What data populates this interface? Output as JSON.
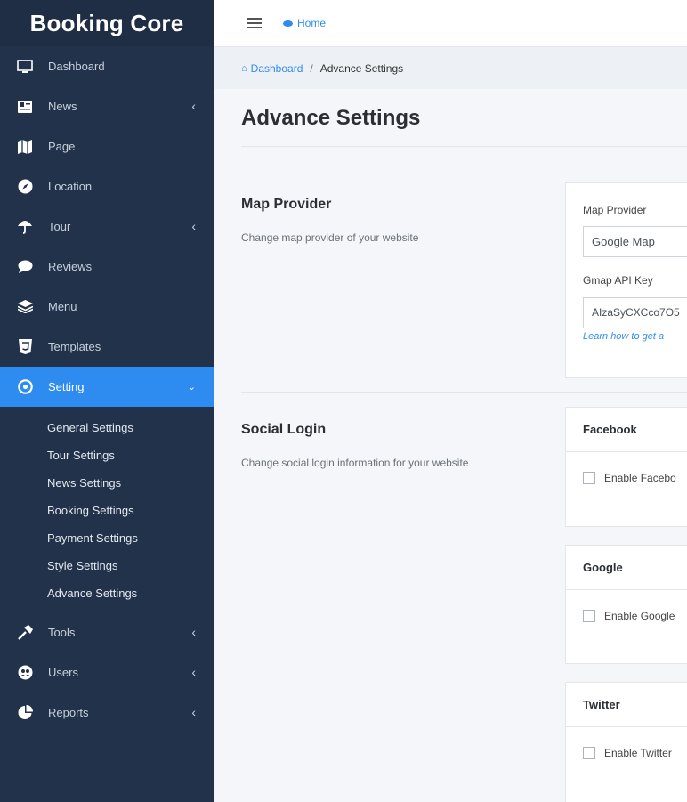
{
  "sidebar": {
    "brand": "Booking Core",
    "items": [
      {
        "label": "Dashboard",
        "icon": "monitor-icon",
        "has_chevron": false
      },
      {
        "label": "News",
        "icon": "newspaper-icon",
        "has_chevron": true
      },
      {
        "label": "Page",
        "icon": "map-icon",
        "has_chevron": false
      },
      {
        "label": "Location",
        "icon": "compass-icon",
        "has_chevron": false
      },
      {
        "label": "Tour",
        "icon": "umbrella-icon",
        "has_chevron": true
      },
      {
        "label": "Reviews",
        "icon": "comment-icon",
        "has_chevron": false
      },
      {
        "label": "Menu",
        "icon": "layers-icon",
        "has_chevron": false
      },
      {
        "label": "Templates",
        "icon": "html5-icon",
        "has_chevron": false
      },
      {
        "label": "Setting",
        "icon": "cog-icon",
        "has_chevron": true,
        "active": true
      }
    ],
    "submenu": [
      "General Settings",
      "Tour Settings",
      "News Settings",
      "Booking Settings",
      "Payment Settings",
      "Style Settings",
      "Advance Settings"
    ],
    "items_after": [
      {
        "label": "Tools",
        "icon": "hammer-icon",
        "has_chevron": true
      },
      {
        "label": "Users",
        "icon": "users-icon",
        "has_chevron": true
      },
      {
        "label": "Reports",
        "icon": "pie-chart-icon",
        "has_chevron": true
      }
    ]
  },
  "topbar": {
    "home_label": "Home"
  },
  "breadcrumb": {
    "root": "Dashboard",
    "separator": "/",
    "current": "Advance Settings"
  },
  "page": {
    "title": "Advance Settings"
  },
  "map_provider": {
    "title": "Map Provider",
    "description": "Change map provider of your website",
    "provider_label": "Map Provider",
    "provider_value": "Google Map",
    "api_key_label": "Gmap API Key",
    "api_key_value": "AIzaSyCXCco7O5",
    "help_link": "Learn how to get a"
  },
  "social_login": {
    "title": "Social Login",
    "description": "Change social login information for your website",
    "facebook": {
      "title": "Facebook",
      "checkbox_label": "Enable Facebo"
    },
    "google": {
      "title": "Google",
      "checkbox_label": "Enable Google"
    },
    "twitter": {
      "title": "Twitter",
      "checkbox_label": "Enable Twitter"
    }
  },
  "colors": {
    "sidebar_bg": "#22324a",
    "accent": "#2e8cf0",
    "content_bg": "#f4f6f9"
  }
}
